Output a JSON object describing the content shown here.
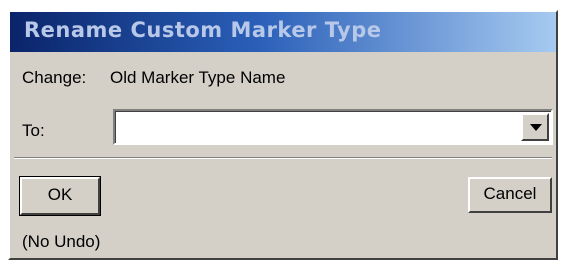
{
  "dialog": {
    "title": "Rename Custom Marker Type",
    "change_label": "Change:",
    "old_name": "Old Marker Type Name",
    "to_label": "To:",
    "to_value": "",
    "ok_label": "OK",
    "cancel_label": "Cancel",
    "note": "(No Undo)"
  },
  "colors": {
    "face": "#d4d0c8",
    "title_gradient_start": "#0a246a",
    "title_gradient_end": "#a6caf0"
  },
  "icons": {
    "dropdown": "chevron-down-icon"
  }
}
